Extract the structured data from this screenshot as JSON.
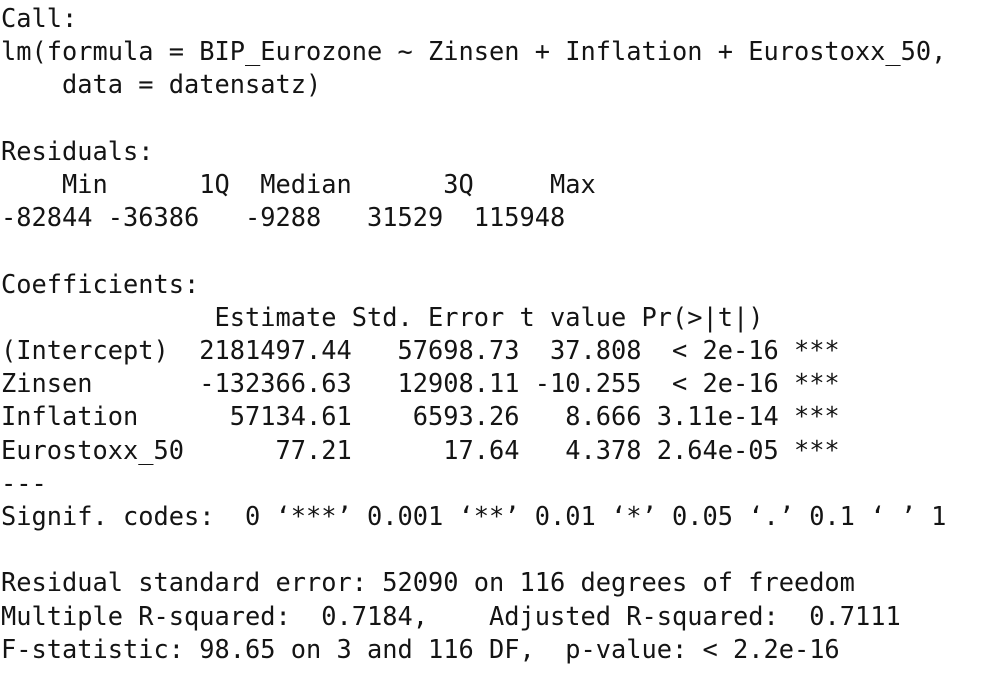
{
  "console": {
    "background_color": "#ffffff",
    "text_color": "#141414",
    "font_kind": "monospace",
    "title": "R summary(lm) console output"
  },
  "call": {
    "header": "Call:",
    "line1": "lm(formula = BIP_Eurozone ~ Zinsen + Inflation + Eurostoxx_50,",
    "line2": "    data = datensatz)",
    "formula_response": "BIP_Eurozone",
    "formula_predictors": [
      "Zinsen",
      "Inflation",
      "Eurostoxx_50"
    ],
    "data_argument": "datensatz",
    "function_name": "lm"
  },
  "residuals": {
    "header": "Residuals:",
    "header_line": "    Min      1Q  Median      3Q     Max ",
    "values_line": "-82844 -36386   -9288   31529  115948 ",
    "labels": [
      "Min",
      "1Q",
      "Median",
      "3Q",
      "Max"
    ],
    "values": [
      -82844,
      -36386,
      -9288,
      31529,
      115948
    ]
  },
  "coefficients": {
    "header": "Coefficients:",
    "column_header_line": "              Estimate Std. Error t value Pr(>|t|)    ",
    "columns": [
      "",
      "Estimate",
      "Std. Error",
      "t value",
      "Pr(>|t|)",
      ""
    ],
    "rows": [
      {
        "term": "(Intercept)",
        "estimate": "2181497.44",
        "std_error": "57698.73",
        "t_value": "37.808",
        "p_value": "< 2e-16",
        "signif": "***",
        "line": "(Intercept)  2181497.44   57698.73  37.808  < 2e-16 ***"
      },
      {
        "term": "Zinsen",
        "estimate": "-132366.63",
        "std_error": "12908.11",
        "t_value": "-10.255",
        "p_value": "< 2e-16",
        "signif": "***",
        "line": "Zinsen       -132366.63   12908.11 -10.255  < 2e-16 ***"
      },
      {
        "term": "Inflation",
        "estimate": "57134.61",
        "std_error": "6593.26",
        "t_value": "8.666",
        "p_value": "3.11e-14",
        "signif": "***",
        "line": "Inflation      57134.61    6593.26   8.666 3.11e-14 ***"
      },
      {
        "term": "Eurostoxx_50",
        "estimate": "77.21",
        "std_error": "17.64",
        "t_value": "4.378",
        "p_value": "2.64e-05",
        "signif": "***",
        "line": "Eurostoxx_50      77.21      17.64   4.378 2.64e-05 ***"
      }
    ],
    "separator": "---",
    "signif_codes_line": "Signif. codes:  0 ‘***’ 0.001 ‘**’ 0.01 ‘*’ 0.05 ‘.’ 0.1 ‘ ’ 1",
    "signif_codes_label": "Signif. codes:"
  },
  "statistics": {
    "residual_standard_error_line": "Residual standard error: 52090 on 116 degrees of freedom",
    "r_squared_line": "Multiple R-squared:  0.7184,\tAdjusted R-squared:  0.7111 ",
    "f_statistic_line": "F-statistic: 98.65 on 3 and 116 DF,  p-value: < 2.2e-16",
    "residual_standard_error": "52090",
    "residual_df": "116",
    "multiple_r_squared": "0.7184",
    "adjusted_r_squared": "0.7111",
    "f_statistic": "98.65",
    "f_df_numerator": "3",
    "f_df_denominator": "116",
    "p_value": "< 2.2e-16"
  }
}
